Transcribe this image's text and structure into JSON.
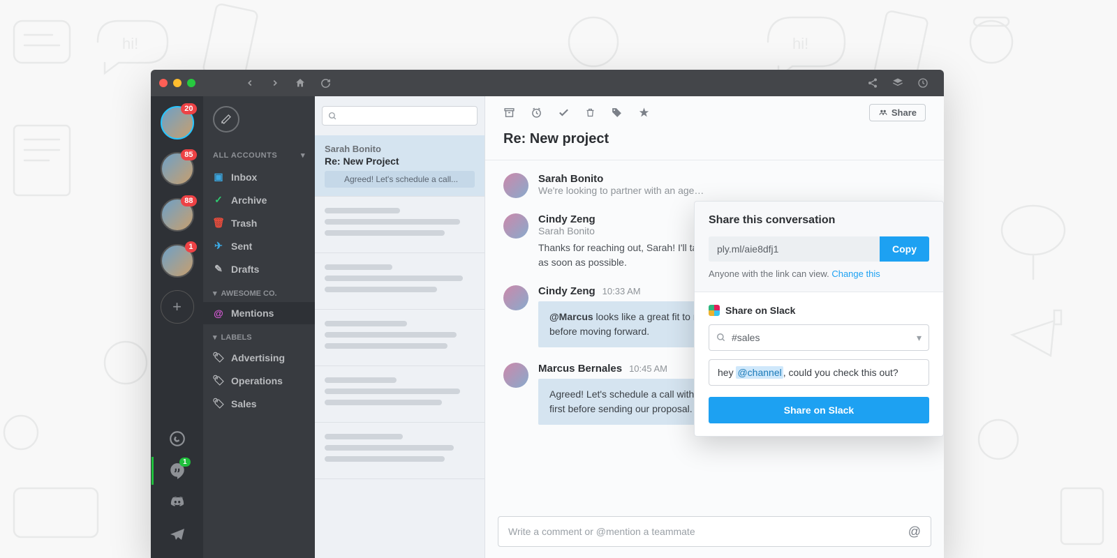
{
  "rail": {
    "accounts": [
      {
        "badge": "20",
        "active": true
      },
      {
        "badge": "85"
      },
      {
        "badge": "88"
      },
      {
        "badge": "1"
      }
    ],
    "hangouts_badge": "1"
  },
  "sidebar": {
    "all_accounts": "ALL ACCOUNTS",
    "items": {
      "inbox": "Inbox",
      "archive": "Archive",
      "trash": "Trash",
      "sent": "Sent",
      "drafts": "Drafts"
    },
    "group": "AWESOME CO.",
    "mentions": "Mentions",
    "labels_header": "LABELS",
    "labels": [
      "Advertising",
      "Operations",
      "Sales"
    ]
  },
  "thread": {
    "name": "Sarah Bonito",
    "subject": "Re:  New Project",
    "preview": "Agreed! Let's schedule a call..."
  },
  "content": {
    "subject": "Re: New project",
    "share_label": "Share",
    "messages": [
      {
        "name": "Sarah Bonito",
        "sub": "We're looking to partner with an age…"
      },
      {
        "name": "Cindy Zeng",
        "sub": "Sarah Bonito",
        "text": "Thanks for reaching out, Sarah! I'll take a look and will put together a timeline and pricing as soon as possible."
      },
      {
        "name": "Cindy Zeng",
        "time": "10:33 AM",
        "note_mention": "@Marcus",
        "note_text": " looks like a great fit to me. What do you think? Let me know outline before moving forward."
      },
      {
        "name": "Marcus Bernales",
        "time": "10:45 AM",
        "note_text": "Agreed! Let's schedule a call with Sarah next week, I'd like to ask a few questions first before sending our proposal."
      }
    ],
    "comment_placeholder": "Write a comment or @mention a teammate"
  },
  "share": {
    "title": "Share this conversation",
    "link": "ply.ml/aie8dfj1",
    "copy": "Copy",
    "perm_text": "Anyone with the link can view. ",
    "perm_link": "Change this",
    "slack_header": "Share on Slack",
    "channel": "#sales",
    "msg_pre": "hey ",
    "msg_mention": "@channel",
    "msg_post": ", could you check this out?",
    "slack_btn": "Share on Slack"
  }
}
